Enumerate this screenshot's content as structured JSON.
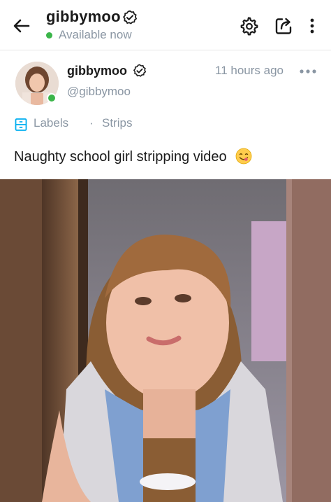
{
  "header": {
    "username": "gibbymoo",
    "status": "Available now",
    "icons": [
      "back-arrow-icon",
      "verified-icon",
      "settings-icon",
      "share-icon",
      "more-vertical-icon"
    ],
    "status_color": "#3bb54a"
  },
  "post": {
    "author_name": "gibbymoo",
    "author_handle": "@gibbymoo",
    "timestamp": "11 hours ago",
    "labels_label": "Labels",
    "labels_value": "Strips",
    "separator": "·",
    "caption": "Naughty school girl stripping video",
    "caption_emoji": "face-savoring-food-emoji"
  },
  "colors": {
    "muted_text": "#8a96a3",
    "accent_blue": "#00aff0",
    "online_green": "#3bb54a"
  }
}
